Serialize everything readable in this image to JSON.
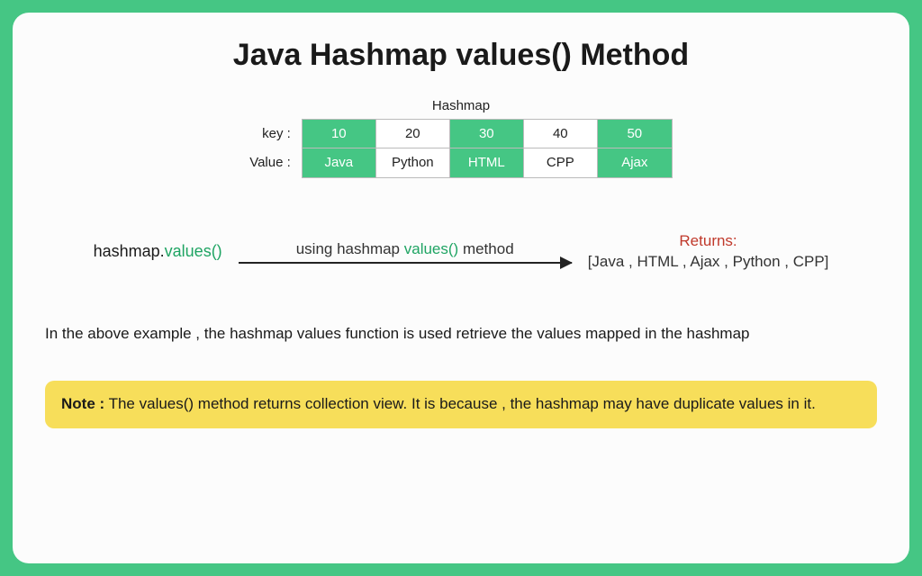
{
  "title": "Java Hashmap values() Method",
  "table": {
    "caption": "Hashmap",
    "keyLabel": "key :",
    "valueLabel": "Value :",
    "keys": [
      "10",
      "20",
      "30",
      "40",
      "50"
    ],
    "values": [
      "Java",
      "Python",
      "HTML",
      "CPP",
      "Ajax"
    ],
    "highlights": [
      true,
      false,
      true,
      false,
      true
    ]
  },
  "flow": {
    "callPrefix": "hashmap.",
    "callMethod": "values()",
    "arrowPrefix": "using hashmap ",
    "arrowMethod": "values()",
    "arrowSuffix": " method",
    "returnsLabel": "Returns:",
    "returnsValue": "[Java , HTML , Ajax , Python , CPP]"
  },
  "description": "In the above example , the hashmap values function is used retrieve the values mapped in the hashmap",
  "note": {
    "title": "Note :",
    "body": "The values() method returns collection view. It is because , the hashmap may have duplicate values in it."
  }
}
